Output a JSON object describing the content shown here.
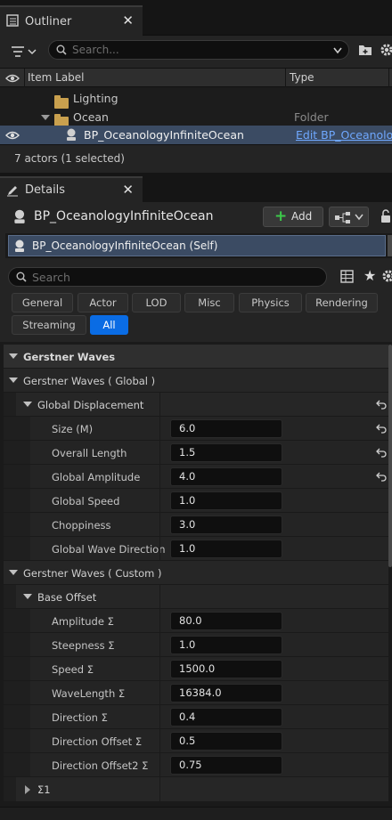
{
  "outliner": {
    "tab_title": "Outliner",
    "close": "✕",
    "search_placeholder": "Search...",
    "columns": {
      "label": "Item Label",
      "type": "Type"
    },
    "rows": [
      {
        "label": "Lighting",
        "type": ""
      },
      {
        "label": "Ocean",
        "type": "Folder"
      },
      {
        "label": "BP_OceanologyInfiniteOcean",
        "type": "Edit BP_Oceanology"
      }
    ],
    "status": "7 actors (1 selected)"
  },
  "details": {
    "tab_title": "Details",
    "close": "✕",
    "actor_name": "BP_OceanologyInfiniteOcean",
    "add_label": "Add",
    "component_self": "BP_OceanologyInfiniteOcean (Self)",
    "search_placeholder": "Search",
    "filters": [
      "General",
      "Actor",
      "LOD",
      "Misc",
      "Physics",
      "Rendering",
      "Streaming",
      "All"
    ],
    "active_filter": "All",
    "section_title": "Gerstner Waves",
    "global_group": "Gerstner Waves ( Global )",
    "global_displacement": "Global Displacement",
    "global_props": [
      {
        "label": "Size (M)",
        "value": "6.0"
      },
      {
        "label": "Overall Length",
        "value": "1.5"
      },
      {
        "label": "Global Amplitude",
        "value": "4.0"
      },
      {
        "label": "Global Speed",
        "value": "1.0"
      },
      {
        "label": "Choppiness",
        "value": "3.0"
      },
      {
        "label": "Global Wave Direction",
        "value": "1.0"
      }
    ],
    "custom_group": "Gerstner Waves ( Custom )",
    "base_offset": "Base Offset",
    "custom_props": [
      {
        "label": "Amplitude Σ",
        "value": "80.0"
      },
      {
        "label": "Steepness Σ",
        "value": "1.0"
      },
      {
        "label": "Speed Σ",
        "value": "1500.0"
      },
      {
        "label": "WaveLength Σ",
        "value": "16384.0"
      },
      {
        "label": "Direction Σ",
        "value": "0.4"
      },
      {
        "label": "Direction Offset Σ",
        "value": "0.5"
      },
      {
        "label": "Direction Offset2 Σ",
        "value": "0.75"
      }
    ],
    "sigma1": "Σ1"
  },
  "colors": {
    "accent": "#0a6ce4",
    "selected_row": "#3b4b63"
  }
}
